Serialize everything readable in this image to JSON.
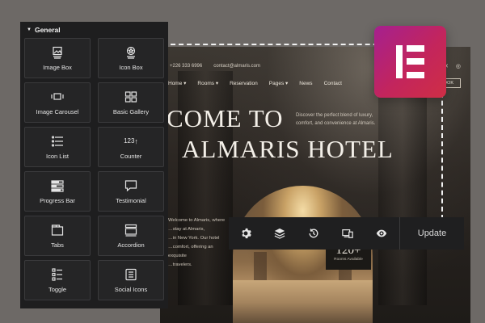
{
  "site": {
    "phone": "+226 333 6996",
    "email": "contact@almaris.com",
    "social_icons": [
      "facebook-icon",
      "x-icon",
      "instagram-icon"
    ],
    "nav": [
      "Home",
      "Rooms",
      "Reservation",
      "Pages",
      "News",
      "Contact"
    ],
    "nav_dropdown": [
      true,
      true,
      false,
      true,
      false,
      false
    ],
    "book_label": "BOOK",
    "hero_line1": "COME TO",
    "hero_line2": "ALMARIS HOTEL",
    "hero_desc": "Discover the perfect blend of luxury, comfort, and convenience at Almaris.",
    "body_lines": [
      "Welcome to Almaris, where",
      "…stay at Almaris,",
      "…in New York. Our hotel",
      "…comfort, offering an exquisite",
      "…travelers."
    ],
    "stat_value": "120+",
    "stat_label": "Rooms Available"
  },
  "panel": {
    "section_title": "General",
    "widgets": [
      {
        "label": "Image Box",
        "icon": "image-box-icon"
      },
      {
        "label": "Icon Box",
        "icon": "icon-box-icon"
      },
      {
        "label": "Image Carousel",
        "icon": "image-carousel-icon"
      },
      {
        "label": "Basic Gallery",
        "icon": "basic-gallery-icon"
      },
      {
        "label": "Icon List",
        "icon": "icon-list-icon"
      },
      {
        "label": "Counter",
        "icon": "counter-icon",
        "glyph": "123"
      },
      {
        "label": "Progress Bar",
        "icon": "progress-bar-icon"
      },
      {
        "label": "Testimonial",
        "icon": "testimonial-icon"
      },
      {
        "label": "Tabs",
        "icon": "tabs-icon"
      },
      {
        "label": "Accordion",
        "icon": "accordion-icon"
      },
      {
        "label": "Toggle",
        "icon": "toggle-icon"
      },
      {
        "label": "Social Icons",
        "icon": "social-icons-icon"
      }
    ]
  },
  "toolbar": {
    "buttons": [
      "settings-icon",
      "layers-icon",
      "history-icon",
      "responsive-icon",
      "preview-icon"
    ],
    "update_label": "Update"
  },
  "colors": {
    "background": "#6d6966",
    "panel": "#1e1e1f",
    "tile": "#252526",
    "logo_gradient_start": "#a5208f",
    "logo_gradient_end": "#cf2e45"
  }
}
